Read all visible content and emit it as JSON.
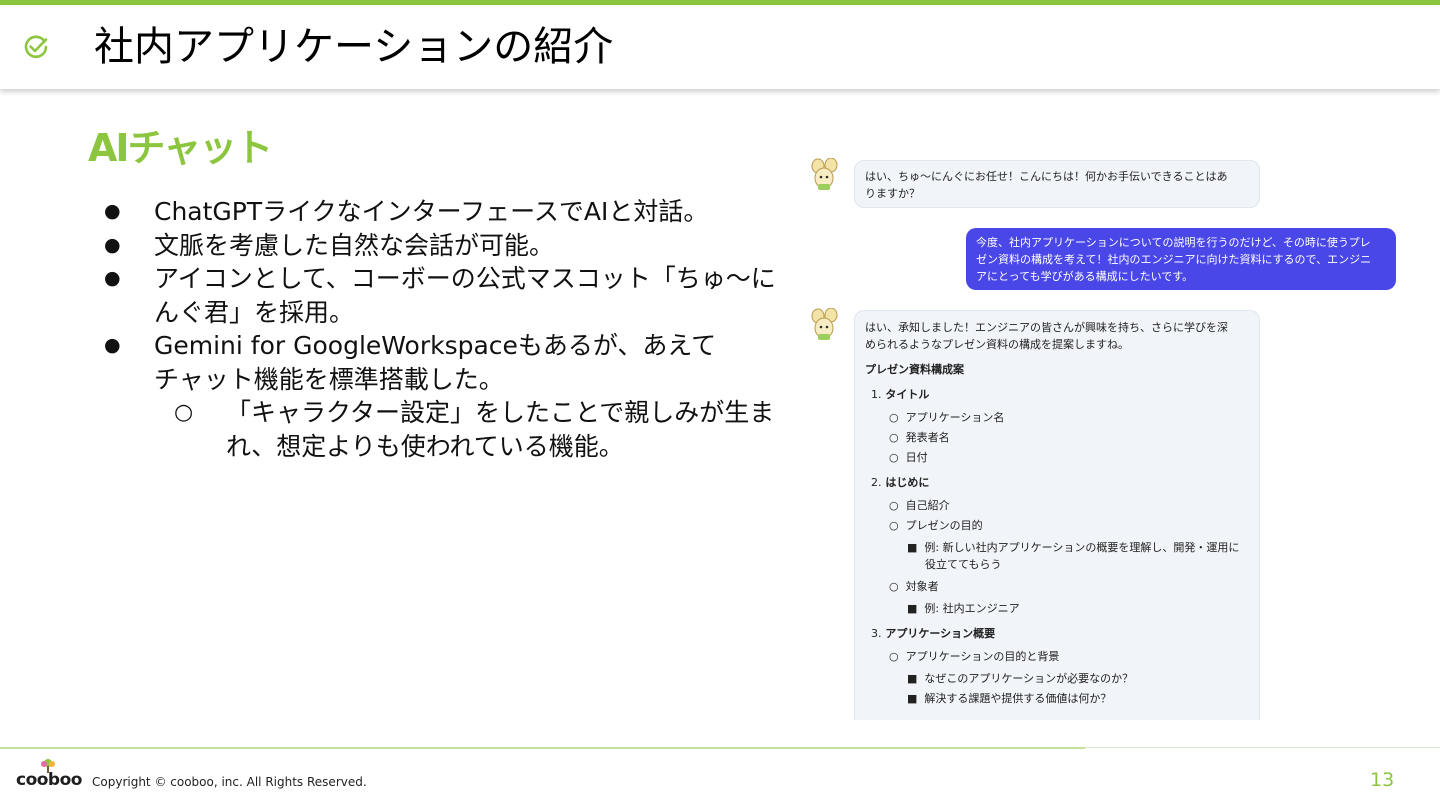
{
  "slide": {
    "title": "社内アプリケーションの紹介",
    "section_title": "AIチャット",
    "page_number": "13",
    "accent_color": "#8cc63f"
  },
  "bullets": [
    {
      "level": 1,
      "lines": [
        "ChatGPTライクなインターフェースでAIと対話。"
      ]
    },
    {
      "level": 1,
      "lines": [
        "文脈を考慮した自然な会話が可能。"
      ]
    },
    {
      "level": 1,
      "lines": [
        "アイコンとして、コーボーの公式マスコット「ちゅ～に",
        "んぐ君」を採用。"
      ]
    },
    {
      "level": 1,
      "lines": [
        "Gemini for GoogleWorkspaceもあるが、あえて",
        "チャット機能を標準搭載した。"
      ]
    },
    {
      "level": 2,
      "lines": [
        "「キャラクター設定」をしたことで親しみが生ま",
        "れ、想定よりも使われている機能。"
      ]
    }
  ],
  "bullet_markers": {
    "level1": "●",
    "level2": "○"
  },
  "chat": {
    "bot_message_1": [
      "はい、ちゅ～にんぐにお任せ！こんにちは！何かお手伝いできることはあ",
      "りますか？"
    ],
    "user_message": [
      "今度、社内アプリケーションについての説明を行うのだけど、その時に使うプレ",
      "ゼン資料の構成を考えて！社内のエンジニアに向けた資料にするので、エンジニ",
      "アにとっても学びがある構成にしたいです。"
    ],
    "bot_message_2": {
      "intro": [
        "はい、承知しました！エンジニアの皆さんが興味を持ち、さらに学びを深",
        "められるようなプレゼン資料の構成を提案しますね。"
      ],
      "heading": "プレゼン資料構成案",
      "sections": [
        {
          "num": "1.",
          "title": "タイトル"
        },
        {
          "num": "2.",
          "title": "はじめに"
        },
        {
          "num": "3.",
          "title": "アプリケーション概要"
        }
      ],
      "items": {
        "s1": [
          "アプリケーション名",
          "発表者名",
          "日付"
        ],
        "s2_a": "自己紹介",
        "s2_b": "プレゼンの目的",
        "s2_b_example": [
          "例: 新しい社内アプリケーションの概要を理解し、開発・運用に",
          "役立ててもらう"
        ],
        "s2_c": "対象者",
        "s2_c_example": "例: 社内エンジニア",
        "s3_a": "アプリケーションの目的と背景",
        "s3_a_items": [
          "なぜこのアプリケーションが必要なのか？",
          "解決する課題や提供する価値は何か？"
        ]
      }
    },
    "user_bubble_color": "#4a47e8",
    "bot_bubble_color": "#f1f4f8"
  },
  "footer": {
    "logo_text": "cooboo",
    "copyright": "Copyright ©  cooboo, inc. All Rights Reserved."
  }
}
